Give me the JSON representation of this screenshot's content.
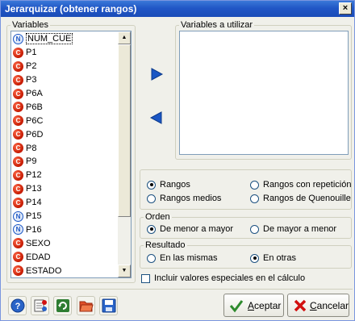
{
  "window": {
    "title": "Jerarquizar (obtener rangos)",
    "close_symbol": "×"
  },
  "variables_panel": {
    "legend": "Variables",
    "items": [
      {
        "type": "N",
        "label": "NUM_CUE",
        "selected": true
      },
      {
        "type": "C",
        "label": "P1"
      },
      {
        "type": "C",
        "label": "P2"
      },
      {
        "type": "C",
        "label": "P3"
      },
      {
        "type": "C",
        "label": "P6A"
      },
      {
        "type": "C",
        "label": "P6B"
      },
      {
        "type": "C",
        "label": "P6C"
      },
      {
        "type": "C",
        "label": "P6D"
      },
      {
        "type": "C",
        "label": "P8"
      },
      {
        "type": "C",
        "label": "P9"
      },
      {
        "type": "C",
        "label": "P12"
      },
      {
        "type": "C",
        "label": "P13"
      },
      {
        "type": "C",
        "label": "P14"
      },
      {
        "type": "N",
        "label": "P15"
      },
      {
        "type": "N",
        "label": "P16"
      },
      {
        "type": "C",
        "label": "SEXO"
      },
      {
        "type": "C",
        "label": "EDAD"
      },
      {
        "type": "C",
        "label": "ESTADO"
      }
    ]
  },
  "selected_panel": {
    "legend": "Variables a utilizar"
  },
  "rank_type": {
    "options": [
      {
        "label": "Rangos",
        "checked": true
      },
      {
        "label": "Rangos con repetición",
        "checked": false
      },
      {
        "label": "Rangos medios",
        "checked": false
      },
      {
        "label": "Rangos de Quenouille",
        "checked": false
      }
    ]
  },
  "orden": {
    "legend": "Orden",
    "options": [
      {
        "label": "De menor a mayor",
        "checked": true
      },
      {
        "label": "De mayor a menor",
        "checked": false
      }
    ]
  },
  "resultado": {
    "legend": "Resultado",
    "options": [
      {
        "label": "En las mismas",
        "checked": false
      },
      {
        "label": "En otras",
        "checked": true
      }
    ]
  },
  "special_values": {
    "label": "Incluir valores especiales en el cálculo",
    "checked": false
  },
  "buttons": {
    "accept_rest": "ceptar",
    "accept_key": "A",
    "cancel_pre": "",
    "cancel_key": "C",
    "cancel_rest": "ancelar"
  },
  "colors": {
    "titlebar": "#2157c6",
    "arrow_blue": "#1a56c4",
    "cancel_red": "#d21010",
    "accept_green": "#2e8b2e"
  },
  "icons": {
    "toolbar": [
      "help-icon",
      "variables-icon",
      "refresh-icon",
      "folder-open-icon",
      "save-icon"
    ]
  }
}
